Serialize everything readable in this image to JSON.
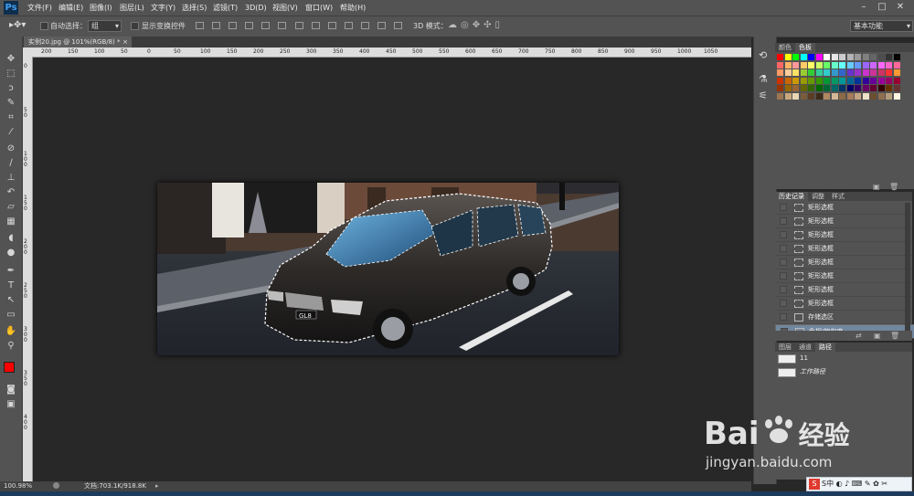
{
  "menubar": {
    "logo": "Ps",
    "items": [
      "文件(F)",
      "编辑(E)",
      "图像(I)",
      "图层(L)",
      "文字(Y)",
      "选择(S)",
      "滤镜(T)",
      "3D(D)",
      "视图(V)",
      "窗口(W)",
      "帮助(H)"
    ],
    "window_buttons": [
      "–",
      "□",
      "✕"
    ]
  },
  "options": {
    "auto_select_label": "自动选择：",
    "auto_select_value": "组",
    "show_transform_label": "显示变换控件",
    "mode_3d_label": "3D 模式：",
    "workspace_value": "基本功能"
  },
  "document": {
    "tab_title": "实例20.jpg @ 101%(RGB/8) *",
    "tab_close": "×",
    "ruler_top_labels": [
      "200",
      "150",
      "100",
      "50",
      "0",
      "50",
      "100",
      "150",
      "200",
      "250",
      "300",
      "350",
      "400",
      "450",
      "500",
      "550",
      "600",
      "650",
      "700",
      "750",
      "800",
      "850",
      "900",
      "950",
      "1000",
      "1050"
    ],
    "ruler_left_labels": [
      "0",
      "5 0",
      "1 0 0",
      "1 5 0",
      "2 0 0",
      "2 5 0",
      "3 0 0",
      "3 5 0",
      "4 0 0"
    ],
    "plate_text": "GL8"
  },
  "status": {
    "zoom": "100.98%",
    "doc_info": "文档:703.1K/918.8K"
  },
  "panels": {
    "swatches_tabs": [
      "颜色",
      "色板"
    ],
    "swatch_colors": [
      "#ff0000",
      "#ffff00",
      "#00ff00",
      "#00ffff",
      "#0000ff",
      "#ff00ff",
      "#ffffff",
      "#e6e6e6",
      "#cccccc",
      "#b3b3b3",
      "#999999",
      "#808080",
      "#666666",
      "#4d4d4d",
      "#333333",
      "#000000",
      "#ff6666",
      "#ffb366",
      "#ff9999",
      "#ffcc66",
      "#ffff66",
      "#ccff66",
      "#66ff66",
      "#66ffcc",
      "#66ffff",
      "#66ccff",
      "#6699ff",
      "#9966ff",
      "#cc66ff",
      "#ff66ff",
      "#ff66cc",
      "#ff6699",
      "#ff9966",
      "#ffcc99",
      "#ffe066",
      "#99cc33",
      "#33cc33",
      "#33cc99",
      "#33cccc",
      "#3399cc",
      "#3366cc",
      "#6633cc",
      "#9933cc",
      "#cc33cc",
      "#cc3399",
      "#cc3366",
      "#ff3333",
      "#ff9933",
      "#cc3300",
      "#cc6600",
      "#cc9900",
      "#999900",
      "#669900",
      "#339900",
      "#009933",
      "#009966",
      "#009999",
      "#006699",
      "#003399",
      "#330099",
      "#660099",
      "#990099",
      "#990066",
      "#990033",
      "#993300",
      "#996600",
      "#996633",
      "#666600",
      "#336600",
      "#006600",
      "#006633",
      "#006666",
      "#003366",
      "#000066",
      "#330066",
      "#660066",
      "#660033",
      "#330000",
      "#663300",
      "#663333",
      "#9b7653",
      "#c9a77c",
      "#e8d6b5",
      "#7a5c3c",
      "#5c3d23",
      "#3d2a19",
      "#b08860",
      "#d4b896",
      "#8c6a46",
      "#a67b5b",
      "#c4a484",
      "#ede0c8",
      "#6b4f2f",
      "#8f6f4f",
      "#b39c7a",
      "#fff5e1"
    ],
    "history_tabs": [
      "历史记录",
      "调整",
      "样式"
    ],
    "history_items": [
      "矩形选框",
      "矩形选框",
      "矩形选框",
      "矩形选框",
      "矩形选框",
      "矩形选框",
      "矩形选框",
      "矩形选框",
      "存储选区",
      "色相/饱和度"
    ],
    "paths_tabs": [
      "图层",
      "通道",
      "路径"
    ],
    "paths_items": [
      "11",
      "工作路径"
    ]
  },
  "watermark": {
    "brand": "Bai",
    "brand_tail": "经验",
    "url": "jingyan.baidu.com"
  },
  "ime": {
    "label": "S中 ◐ ♪ ⌨ ✎ ✿ ✂"
  }
}
